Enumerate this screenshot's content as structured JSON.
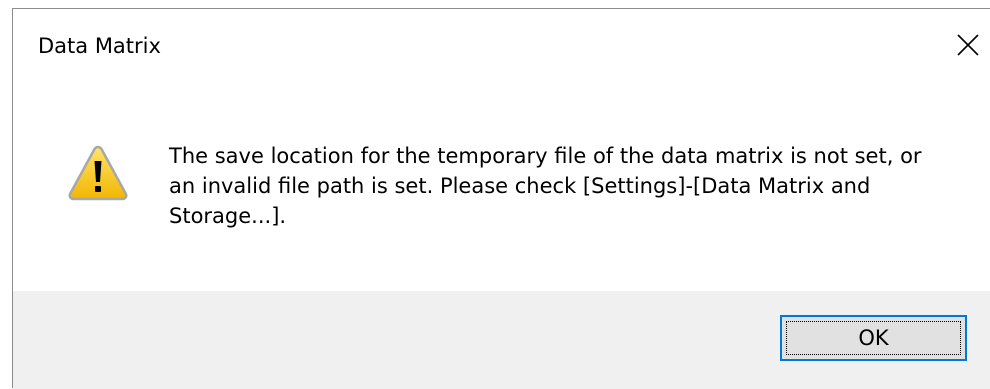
{
  "window": {
    "title": "Data Matrix",
    "close_icon": "close-icon"
  },
  "message": {
    "icon": "warning-icon",
    "text": "The save location for the temporary file of the data matrix is not set, or an invalid file path is set. Please check [Settings]-[Data Matrix and Storage...]."
  },
  "buttons": {
    "ok_label": "OK"
  },
  "colors": {
    "footer_background": "#f0f0f0",
    "button_border_focus": "#0078d7",
    "warning_fill": "#f5c518"
  }
}
